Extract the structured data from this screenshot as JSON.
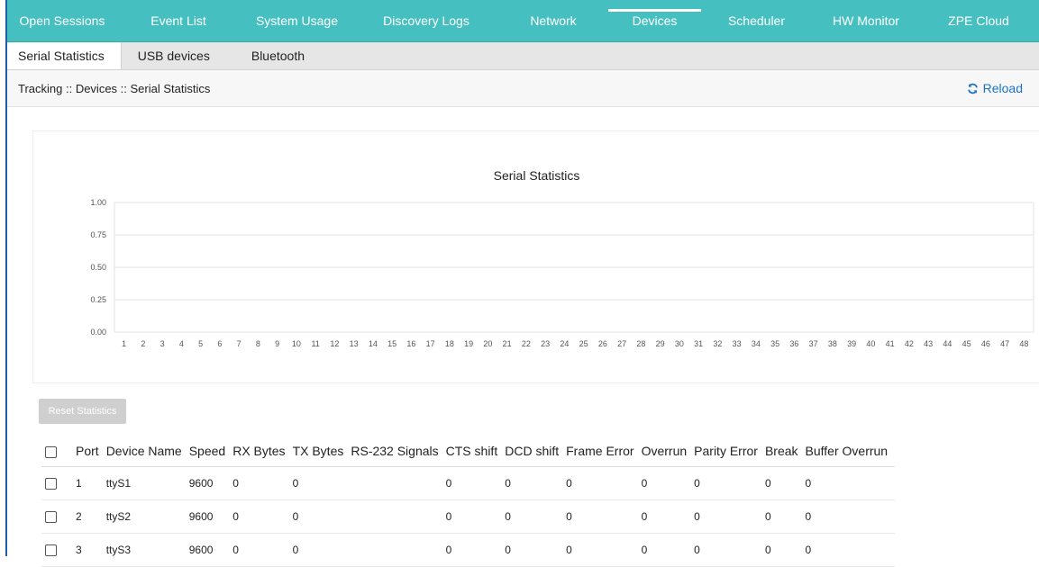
{
  "top_nav": [
    {
      "label": "Open Sessions",
      "active": false
    },
    {
      "label": "Event List",
      "active": false
    },
    {
      "label": "System Usage",
      "active": false
    },
    {
      "label": "Discovery Logs",
      "active": false
    },
    {
      "label": "Network",
      "active": false
    },
    {
      "label": "Devices",
      "active": true
    },
    {
      "label": "Scheduler",
      "active": false
    },
    {
      "label": "HW Monitor",
      "active": false
    },
    {
      "label": "ZPE Cloud",
      "active": false
    }
  ],
  "sub_tabs": [
    {
      "label": "Serial Statistics",
      "active": true
    },
    {
      "label": "USB devices",
      "active": false
    },
    {
      "label": "Bluetooth",
      "active": false
    }
  ],
  "breadcrumb": "Tracking :: Devices :: Serial Statistics",
  "reload_label": "Reload",
  "reload_icon": "refresh-icon",
  "reset_button": "Reset Statistics",
  "chart_data": {
    "type": "bar",
    "title": "Serial Statistics",
    "categories": [
      "1",
      "2",
      "3",
      "4",
      "5",
      "6",
      "7",
      "8",
      "9",
      "10",
      "11",
      "12",
      "13",
      "14",
      "15",
      "16",
      "17",
      "18",
      "19",
      "20",
      "21",
      "22",
      "23",
      "24",
      "25",
      "26",
      "27",
      "28",
      "29",
      "30",
      "31",
      "32",
      "33",
      "34",
      "35",
      "36",
      "37",
      "38",
      "39",
      "40",
      "41",
      "42",
      "43",
      "44",
      "45",
      "46",
      "47",
      "48"
    ],
    "yticks": [
      "1.00",
      "0.75",
      "0.50",
      "0.25",
      "0.00"
    ],
    "values": [
      0,
      0,
      0,
      0,
      0,
      0,
      0,
      0,
      0,
      0,
      0,
      0,
      0,
      0,
      0,
      0,
      0,
      0,
      0,
      0,
      0,
      0,
      0,
      0,
      0,
      0,
      0,
      0,
      0,
      0,
      0,
      0,
      0,
      0,
      0,
      0,
      0,
      0,
      0,
      0,
      0,
      0,
      0,
      0,
      0,
      0,
      0,
      0
    ],
    "ylim": [
      0,
      1
    ],
    "grid": true
  },
  "table": {
    "columns": [
      "Port",
      "Device Name",
      "Speed",
      "RX Bytes",
      "TX Bytes",
      "RS-232 Signals",
      "CTS shift",
      "DCD shift",
      "Frame Error",
      "Overrun",
      "Parity Error",
      "Break",
      "Buffer Overrun"
    ],
    "rows": [
      [
        "1",
        "ttyS1",
        "9600",
        "0",
        "0",
        "",
        "0",
        "0",
        "0",
        "0",
        "0",
        "0",
        "0"
      ],
      [
        "2",
        "ttyS2",
        "9600",
        "0",
        "0",
        "",
        "0",
        "0",
        "0",
        "0",
        "0",
        "0",
        "0"
      ],
      [
        "3",
        "ttyS3",
        "9600",
        "0",
        "0",
        "",
        "0",
        "0",
        "0",
        "0",
        "0",
        "0",
        "0"
      ]
    ]
  },
  "colors": {
    "nav_bg": "#46bfc0",
    "link": "#1a73c7",
    "grid": "#e3e3e3"
  }
}
